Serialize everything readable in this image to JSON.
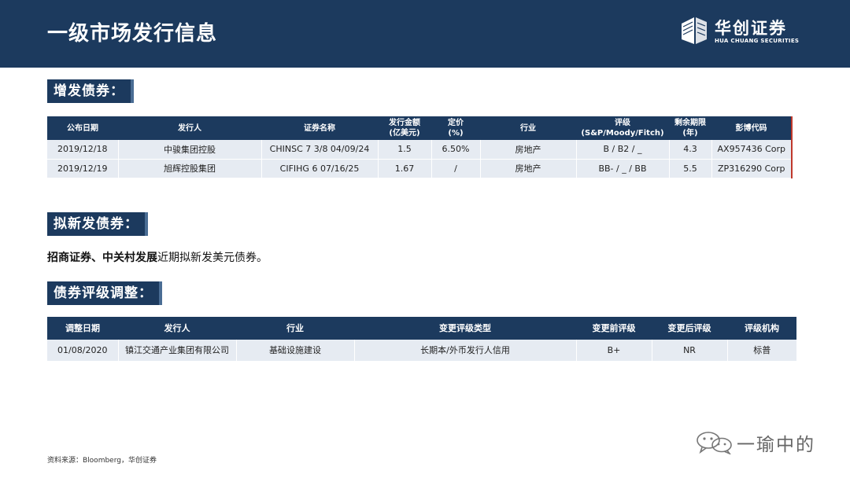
{
  "header": {
    "title": "一级市场发行信息",
    "logo_cn": "华创证券",
    "logo_en": "HUA CHUANG SECURITIES"
  },
  "sections": {
    "new_issue": "增发债券：",
    "planned": "拟新发债券：",
    "rating": "债券评级调整："
  },
  "new_issue_table": {
    "columns": [
      "公布日期",
      "发行人",
      "证券名称",
      [
        "发行金额",
        "(亿美元)"
      ],
      [
        "定价",
        "(%)"
      ],
      "行业",
      [
        "评级",
        "(S&P/Moody/Fitch)"
      ],
      [
        "剩余期限",
        "(年)"
      ],
      "彭博代码"
    ],
    "rows": [
      [
        "2019/12/18",
        "中骏集团控股",
        "CHINSC 7 3/8 04/09/24",
        "1.5",
        "6.50%",
        "房地产",
        "B / B2 / _",
        "4.3",
        "AX957436 Corp"
      ],
      [
        "2019/12/19",
        "旭辉控股集团",
        "CIFIHG 6 07/16/25",
        "1.67",
        "/",
        "房地产",
        "BB- / _ / BB",
        "5.5",
        "ZP316290 Corp"
      ]
    ]
  },
  "planned_text": {
    "bold": "招商证券、中关村发展",
    "rest": "近期拟新发美元债券。"
  },
  "rating_table": {
    "columns": [
      "调整日期",
      "发行人",
      "行业",
      "变更评级类型",
      "变更前评级",
      "变更后评级",
      "评级机构"
    ],
    "rows": [
      [
        "01/08/2020",
        "镇江交通产业集团有限公司",
        "基础设施建设",
        "长期本/外币发行人信用",
        "B+",
        "NR",
        "标普"
      ]
    ]
  },
  "source": "资料来源：Bloomberg，华创证券",
  "watermark": "一瑜中的",
  "colors": {
    "navy": "#1c3a5e",
    "row_bg": "#e6ebf2",
    "accent_red": "#c0392b"
  }
}
